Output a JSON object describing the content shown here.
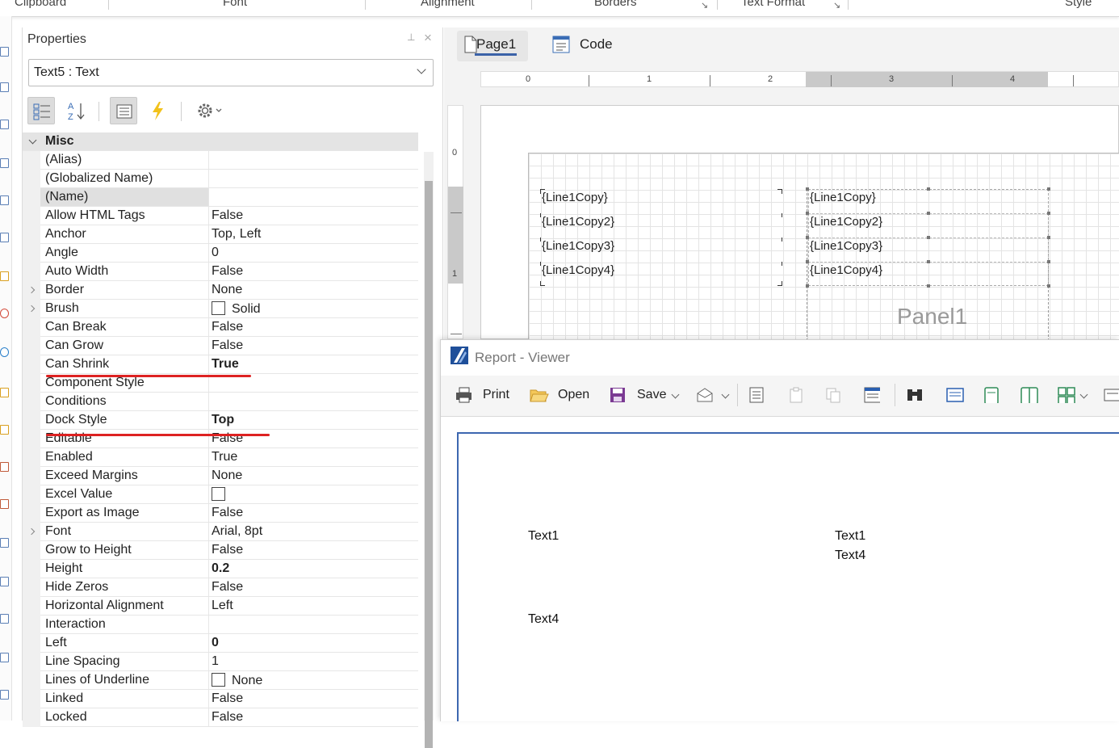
{
  "ribbon": {
    "groups": [
      "Clipboard",
      "Font",
      "Alignment",
      "Borders",
      "Text Format",
      "Style"
    ]
  },
  "properties": {
    "title": "Properties",
    "selected_component": "Text5 : Text",
    "category": "Misc",
    "rows": [
      {
        "name": "(Alias)",
        "value": ""
      },
      {
        "name": "(Globalized Name)",
        "value": ""
      },
      {
        "name": "(Name)",
        "value": ""
      },
      {
        "name": "Allow HTML Tags",
        "value": "False"
      },
      {
        "name": "Anchor",
        "value": "Top, Left"
      },
      {
        "name": "Angle",
        "value": "0"
      },
      {
        "name": "Auto Width",
        "value": "False"
      },
      {
        "name": "Border",
        "value": "None"
      },
      {
        "name": "Brush",
        "value": "Solid"
      },
      {
        "name": "Can Break",
        "value": "False"
      },
      {
        "name": "Can Grow",
        "value": "False"
      },
      {
        "name": "Can Shrink",
        "value": "True"
      },
      {
        "name": "Component Style",
        "value": ""
      },
      {
        "name": "Conditions",
        "value": ""
      },
      {
        "name": "Dock Style",
        "value": "Top"
      },
      {
        "name": "Editable",
        "value": "False"
      },
      {
        "name": "Enabled",
        "value": "True"
      },
      {
        "name": "Exceed Margins",
        "value": "None"
      },
      {
        "name": "Excel Value",
        "value": ""
      },
      {
        "name": "Export as Image",
        "value": "False"
      },
      {
        "name": "Font",
        "value": "Arial, 8pt"
      },
      {
        "name": "Grow to Height",
        "value": "False"
      },
      {
        "name": "Height",
        "value": "0.2"
      },
      {
        "name": "Hide Zeros",
        "value": "False"
      },
      {
        "name": "Horizontal Alignment",
        "value": "Left"
      },
      {
        "name": "Interaction",
        "value": ""
      },
      {
        "name": "Left",
        "value": "0"
      },
      {
        "name": "Line Spacing",
        "value": "1"
      },
      {
        "name": "Lines of Underline",
        "value": "None"
      },
      {
        "name": "Linked",
        "value": "False"
      },
      {
        "name": "Locked",
        "value": "False"
      }
    ]
  },
  "designer": {
    "tabs": [
      "Page1",
      "Code"
    ],
    "ruler_numbers": [
      "0",
      "1",
      "2",
      "3",
      "4"
    ],
    "vruler_numbers": [
      "0",
      "1"
    ],
    "left_texts": [
      "{Line1Copy}",
      "{Line1Copy2}",
      "{Line1Copy3}",
      "{Line1Copy4}"
    ],
    "right_texts": [
      "{Line1Copy}",
      "{Line1Copy2}",
      "{Line1Copy3}",
      "{Line1Copy4}"
    ],
    "panel_label": "Panel1"
  },
  "viewer": {
    "title": "Report - Viewer",
    "toolbar": {
      "print": "Print",
      "open": "Open",
      "save": "Save"
    },
    "texts": {
      "left_top": "Text1",
      "right_top": "Text1",
      "right_second": "Text4",
      "left_bottom": "Text4"
    }
  },
  "colors": {
    "accent": "#3b62a8",
    "annotation_red": "#dd2222"
  }
}
